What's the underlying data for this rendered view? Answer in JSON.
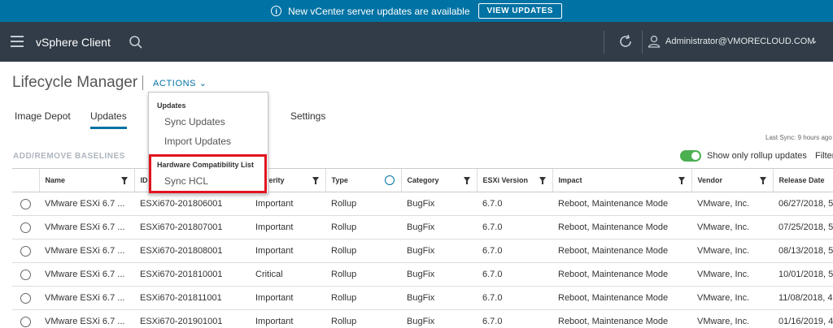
{
  "banner": {
    "message": "New vCenter server updates are available",
    "button_label": "VIEW UPDATES"
  },
  "header": {
    "brand": "vSphere Client",
    "user": "Administrator@VMORECLOUD.COM"
  },
  "page": {
    "title": "Lifecycle Manager",
    "actions_label": "ACTIONS",
    "tabs": [
      "Image Depot",
      "Updates",
      "Settings"
    ],
    "active_tab": "Updates",
    "last_sync": "Last Sync: 9 hours ago",
    "section_label": "ADD/REMOVE BASELINES",
    "rollup_toggle_label": "Show only rollup updates",
    "rollup_toggle_on": true,
    "filter_label": "Filter"
  },
  "actions_menu": {
    "updates_header": "Updates",
    "sync_updates": "Sync Updates",
    "import_updates": "Import Updates",
    "hcl_header": "Hardware Compatibility List",
    "sync_hcl": "Sync HCL"
  },
  "table": {
    "columns": [
      "Name",
      "ID",
      "Severity",
      "Type",
      "Category",
      "ESXi Version",
      "Impact",
      "Vendor",
      "Release Date"
    ],
    "rows": [
      [
        "VMware ESXi 6.7 ...",
        "ESXi670-201806001",
        "Important",
        "Rollup",
        "BugFix",
        "6.7.0",
        "Reboot, Maintenance Mode",
        "VMware, Inc.",
        "06/27/2018, 5"
      ],
      [
        "VMware ESXi 6.7 ...",
        "ESXi670-201807001",
        "Important",
        "Rollup",
        "BugFix",
        "6.7.0",
        "Reboot, Maintenance Mode",
        "VMware, Inc.",
        "07/25/2018, 5"
      ],
      [
        "VMware ESXi 6.7 ...",
        "ESXi670-201808001",
        "Important",
        "Rollup",
        "BugFix",
        "6.7.0",
        "Reboot, Maintenance Mode",
        "VMware, Inc.",
        "08/13/2018, 5"
      ],
      [
        "VMware ESXi 6.7 ...",
        "ESXi670-201810001",
        "Critical",
        "Rollup",
        "BugFix",
        "6.7.0",
        "Reboot, Maintenance Mode",
        "VMware, Inc.",
        "10/01/2018, 5"
      ],
      [
        "VMware ESXi 6.7 ...",
        "ESXi670-201811001",
        "Important",
        "Rollup",
        "BugFix",
        "6.7.0",
        "Reboot, Maintenance Mode",
        "VMware, Inc.",
        "11/08/2018, 4"
      ],
      [
        "VMware ESXi 6.7 ...",
        "ESXi670-201901001",
        "Important",
        "Rollup",
        "BugFix",
        "6.7.0",
        "Reboot, Maintenance Mode",
        "VMware, Inc.",
        "01/16/2019, 4"
      ]
    ]
  },
  "colors": {
    "banner": "#0072a3",
    "header": "#313c48",
    "accent": "#0072a3",
    "toggle_on": "#4caf50",
    "highlight": "#e0141f"
  }
}
